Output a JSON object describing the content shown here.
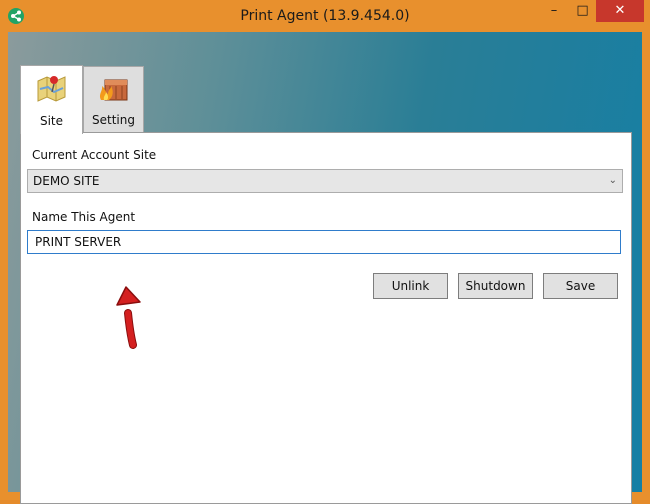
{
  "window": {
    "title": "Print Agent (13.9.454.0)",
    "controls": {
      "minimize": "–",
      "maximize": "□",
      "close": "✕"
    }
  },
  "tabs": [
    {
      "label": "Site",
      "icon": "map-pin-icon",
      "active": true
    },
    {
      "label": "Setting",
      "icon": "toolbox-fire-icon",
      "active": false
    }
  ],
  "site": {
    "account_label": "Current Account Site",
    "account_value": "DEMO SITE",
    "agent_label": "Name This Agent",
    "agent_value": "PRINT SERVER"
  },
  "buttons": {
    "unlink": "Unlink",
    "shutdown": "Shutdown",
    "save": "Save"
  },
  "colors": {
    "accent": "#e8902d",
    "close": "#c7372c",
    "focus": "#2f7ccb",
    "arrow": "#d42020"
  }
}
